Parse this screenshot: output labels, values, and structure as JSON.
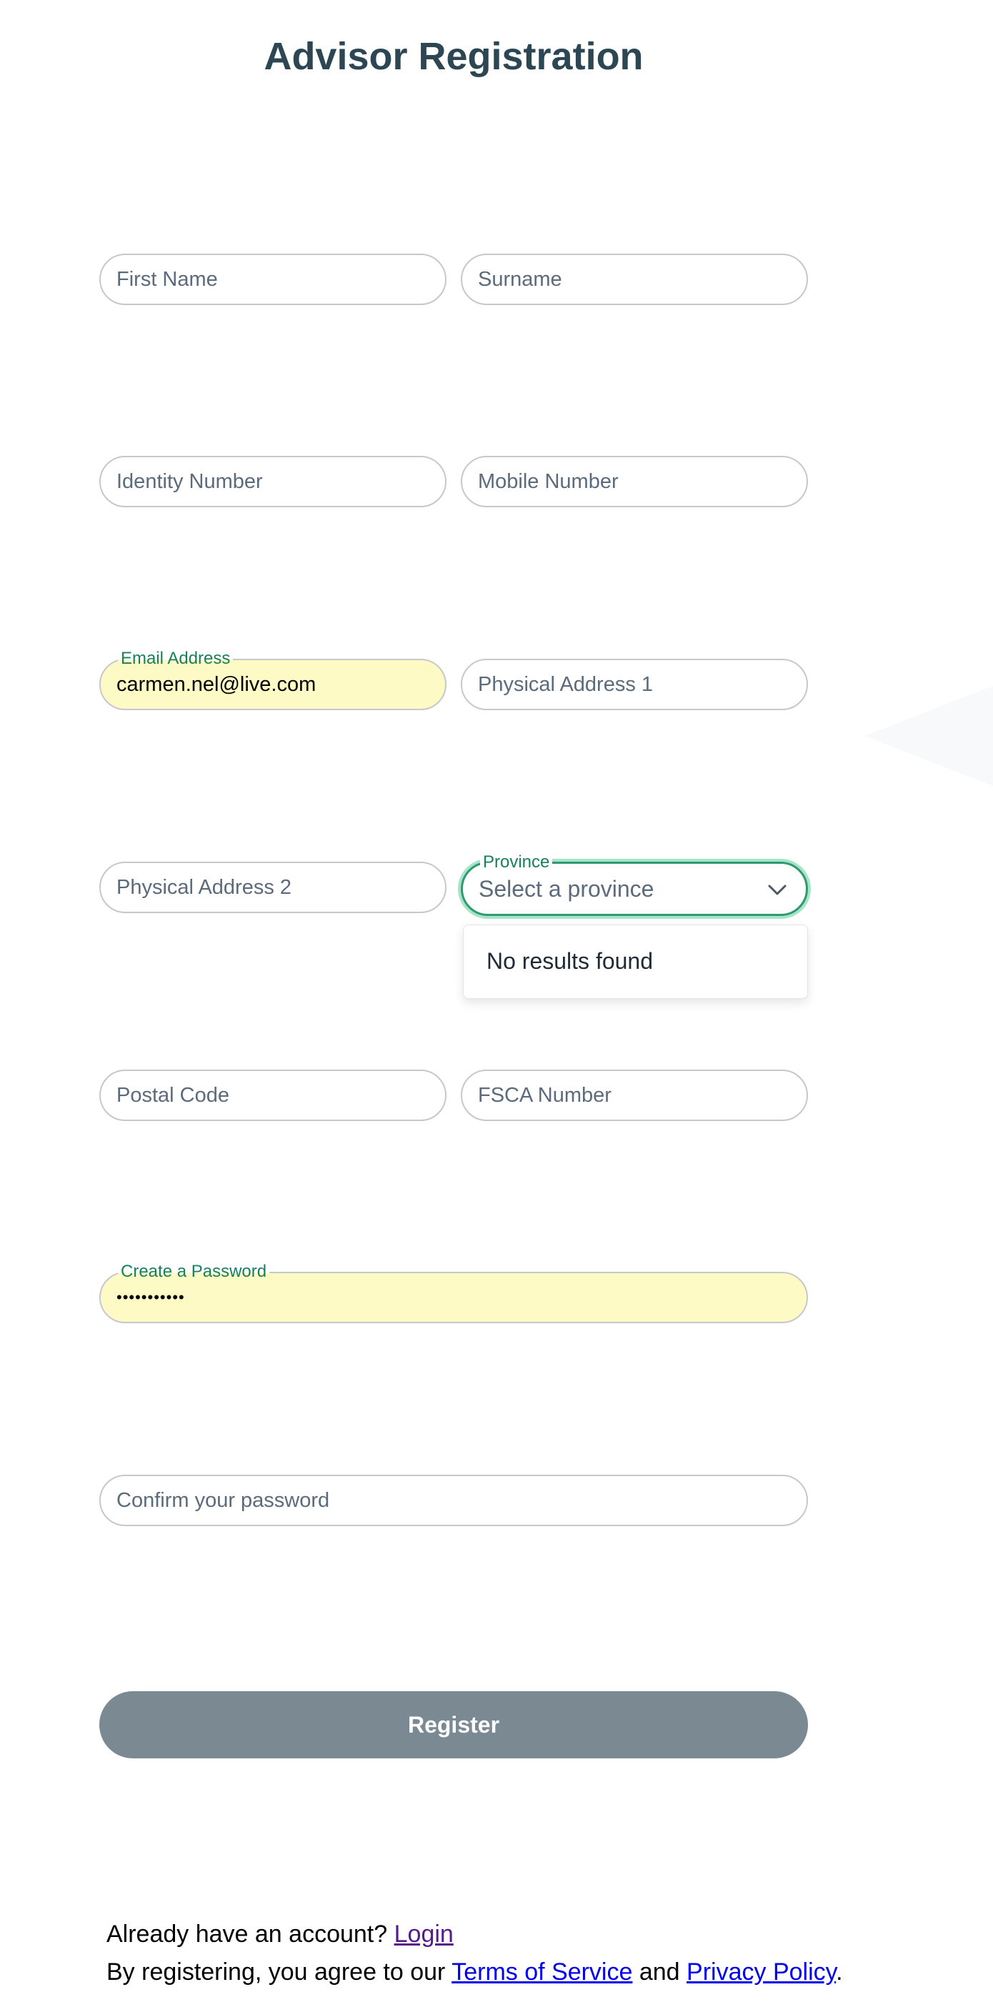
{
  "title": "Advisor Registration",
  "fields": {
    "first_name": {
      "placeholder": "First Name"
    },
    "surname": {
      "placeholder": "Surname"
    },
    "identity_number": {
      "placeholder": "Identity Number"
    },
    "mobile_number": {
      "placeholder": "Mobile Number"
    },
    "email": {
      "label": "Email Address",
      "value": "carmen.nel@live.com"
    },
    "physical_address_1": {
      "placeholder": "Physical Address 1"
    },
    "physical_address_2": {
      "placeholder": "Physical Address 2"
    },
    "province": {
      "label": "Province",
      "placeholder": "Select a province",
      "dropdown_empty": "No results found"
    },
    "postal_code": {
      "placeholder": "Postal Code"
    },
    "fsca_number": {
      "placeholder": "FSCA Number"
    },
    "password": {
      "label": "Create a Password",
      "value": "•••••••••••"
    },
    "confirm_password": {
      "placeholder": "Confirm your password"
    }
  },
  "register_button": "Register",
  "footer": {
    "login_prompt": "Already have an account?",
    "login_link": "Login",
    "terms_prefix": "By registering, you agree to our",
    "terms_link": "Terms of Service",
    "and": "and",
    "privacy_link": "Privacy Policy",
    "period": "."
  },
  "icons": {
    "province_toggle": "chevron-down-icon"
  },
  "colors": {
    "title": "#2c4654",
    "accent": "#17805d",
    "focus_ring": "#a6e5c8",
    "autofill": "#fefac5",
    "button": "#7a8992"
  }
}
